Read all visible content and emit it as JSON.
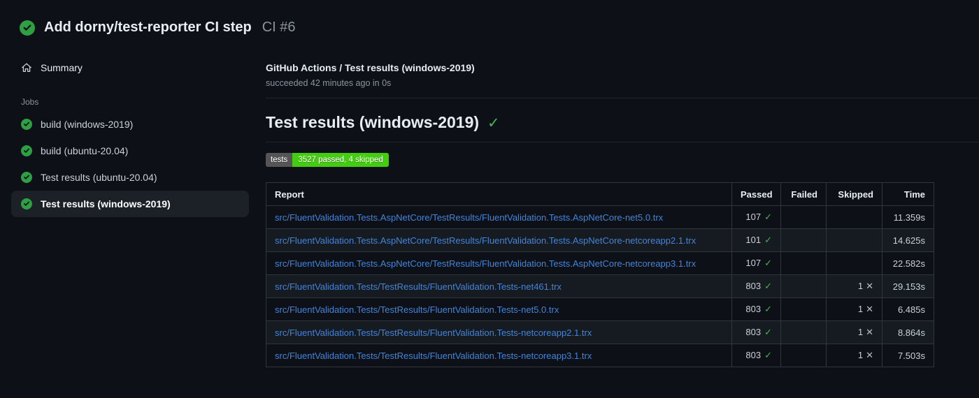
{
  "colors": {
    "bg": "#0d1117",
    "bg-subtle": "#161b22",
    "border": "#30363d",
    "divider": "#21262d",
    "text": "#e6edf3",
    "text-body": "#c9d1d9",
    "text-muted": "#8b949e",
    "link": "#4184d9",
    "green": "#3fb950",
    "green-circle": "#2ea043",
    "selected-bg": "#1c2128",
    "badge-label-bg": "#555555",
    "badge-value-bg": "#44cc11",
    "x-color": "#b7bfc8"
  },
  "run_header": {
    "title": "Add dorny/test-reporter CI step",
    "run_ref": "CI #6",
    "status_icon": "check-circle-icon"
  },
  "sidebar": {
    "summary_label": "Summary",
    "summary_icon": "home-icon",
    "jobs_label": "Jobs",
    "jobs": [
      {
        "label": "build (windows-2019)",
        "selected": false
      },
      {
        "label": "build (ubuntu-20.04)",
        "selected": false
      },
      {
        "label": "Test results (ubuntu-20.04)",
        "selected": false
      },
      {
        "label": "Test results (windows-2019)",
        "selected": true
      }
    ]
  },
  "main": {
    "check_name": "GitHub Actions / Test results (windows-2019)",
    "check_status": "succeeded 42 minutes ago in 0s",
    "heading": "Test results (windows-2019)",
    "heading_check": "✓",
    "badge": {
      "label": "tests",
      "value": "3527 passed, 4 skipped"
    },
    "table": {
      "columns": [
        "Report",
        "Passed",
        "Failed",
        "Skipped",
        "Time"
      ],
      "pass_mark": "✓",
      "skip_mark": "✕",
      "rows": [
        {
          "report": "src/FluentValidation.Tests.AspNetCore/TestResults/FluentValidation.Tests.AspNetCore-net5.0.trx",
          "passed": "107",
          "failed": "",
          "skipped": "",
          "time": "11.359s"
        },
        {
          "report": "src/FluentValidation.Tests.AspNetCore/TestResults/FluentValidation.Tests.AspNetCore-netcoreapp2.1.trx",
          "passed": "101",
          "failed": "",
          "skipped": "",
          "time": "14.625s"
        },
        {
          "report": "src/FluentValidation.Tests.AspNetCore/TestResults/FluentValidation.Tests.AspNetCore-netcoreapp3.1.trx",
          "passed": "107",
          "failed": "",
          "skipped": "",
          "time": "22.582s"
        },
        {
          "report": "src/FluentValidation.Tests/TestResults/FluentValidation.Tests-net461.trx",
          "passed": "803",
          "failed": "",
          "skipped": "1",
          "time": "29.153s"
        },
        {
          "report": "src/FluentValidation.Tests/TestResults/FluentValidation.Tests-net5.0.trx",
          "passed": "803",
          "failed": "",
          "skipped": "1",
          "time": "6.485s"
        },
        {
          "report": "src/FluentValidation.Tests/TestResults/FluentValidation.Tests-netcoreapp2.1.trx",
          "passed": "803",
          "failed": "",
          "skipped": "1",
          "time": "8.864s"
        },
        {
          "report": "src/FluentValidation.Tests/TestResults/FluentValidation.Tests-netcoreapp3.1.trx",
          "passed": "803",
          "failed": "",
          "skipped": "1",
          "time": "7.503s"
        }
      ]
    }
  }
}
